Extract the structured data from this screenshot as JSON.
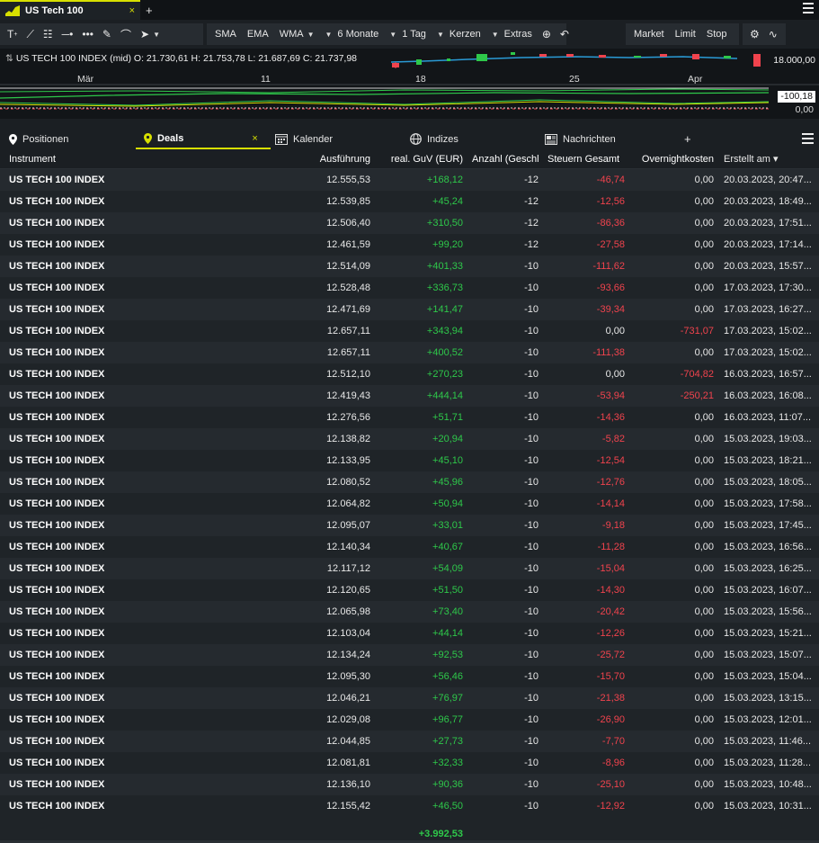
{
  "chart_tab": {
    "label": "US Tech 100",
    "close": "×",
    "add": "+"
  },
  "toolbar": {
    "indicators": [
      "SMA",
      "EMA",
      "WMA"
    ],
    "period": "6 Monate",
    "interval": "1 Tag",
    "chart_type": "Kerzen",
    "extras": "Extras",
    "orders": [
      "Market",
      "Limit",
      "Stop"
    ]
  },
  "chart": {
    "instrument": "US TECH 100 INDEX (mid)",
    "ohlc": "O: 21.730,61  H: 21.753,78  L: 21.687,69  C: 21.737,98",
    "price_level": "18.000,00",
    "dates": [
      "Mär",
      "11",
      "18",
      "25",
      "Apr"
    ],
    "macd_value": "-100,18",
    "macd_zero": "0,00"
  },
  "deal_tabs": {
    "positionen": "Positionen",
    "deals": "Deals",
    "deals_close": "×",
    "kalender": "Kalender",
    "indizes": "Indizes",
    "nachrichten": "Nachrichten",
    "add": "+"
  },
  "table": {
    "headers": [
      "Instrument",
      "Ausführung",
      "real. GuV (EUR)",
      "Anzahl (Geschl",
      "Steuern Gesamt",
      "Overnightkosten",
      "Erstellt am ▾"
    ],
    "rows": [
      [
        "US TECH 100 INDEX",
        "12.555,53",
        "+168,12",
        "-12",
        "-46,74",
        "0,00",
        "20.03.2023, 20:47..."
      ],
      [
        "US TECH 100 INDEX",
        "12.539,85",
        "+45,24",
        "-12",
        "-12,56",
        "0,00",
        "20.03.2023, 18:49..."
      ],
      [
        "US TECH 100 INDEX",
        "12.506,40",
        "+310,50",
        "-12",
        "-86,36",
        "0,00",
        "20.03.2023, 17:51..."
      ],
      [
        "US TECH 100 INDEX",
        "12.461,59",
        "+99,20",
        "-12",
        "-27,58",
        "0,00",
        "20.03.2023, 17:14..."
      ],
      [
        "US TECH 100 INDEX",
        "12.514,09",
        "+401,33",
        "-10",
        "-111,62",
        "0,00",
        "20.03.2023, 15:57..."
      ],
      [
        "US TECH 100 INDEX",
        "12.528,48",
        "+336,73",
        "-10",
        "-93,66",
        "0,00",
        "17.03.2023, 17:30..."
      ],
      [
        "US TECH 100 INDEX",
        "12.471,69",
        "+141,47",
        "-10",
        "-39,34",
        "0,00",
        "17.03.2023, 16:27..."
      ],
      [
        "US TECH 100 INDEX",
        "12.657,11",
        "+343,94",
        "-10",
        "0,00",
        "-731,07",
        "17.03.2023, 15:02..."
      ],
      [
        "US TECH 100 INDEX",
        "12.657,11",
        "+400,52",
        "-10",
        "-111,38",
        "0,00",
        "17.03.2023, 15:02..."
      ],
      [
        "US TECH 100 INDEX",
        "12.512,10",
        "+270,23",
        "-10",
        "0,00",
        "-704,82",
        "16.03.2023, 16:57..."
      ],
      [
        "US TECH 100 INDEX",
        "12.419,43",
        "+444,14",
        "-10",
        "-53,94",
        "-250,21",
        "16.03.2023, 16:08..."
      ],
      [
        "US TECH 100 INDEX",
        "12.276,56",
        "+51,71",
        "-10",
        "-14,36",
        "0,00",
        "16.03.2023, 11:07..."
      ],
      [
        "US TECH 100 INDEX",
        "12.138,82",
        "+20,94",
        "-10",
        "-5,82",
        "0,00",
        "15.03.2023, 19:03..."
      ],
      [
        "US TECH 100 INDEX",
        "12.133,95",
        "+45,10",
        "-10",
        "-12,54",
        "0,00",
        "15.03.2023, 18:21..."
      ],
      [
        "US TECH 100 INDEX",
        "12.080,52",
        "+45,96",
        "-10",
        "-12,76",
        "0,00",
        "15.03.2023, 18:05..."
      ],
      [
        "US TECH 100 INDEX",
        "12.064,82",
        "+50,94",
        "-10",
        "-14,14",
        "0,00",
        "15.03.2023, 17:58..."
      ],
      [
        "US TECH 100 INDEX",
        "12.095,07",
        "+33,01",
        "-10",
        "-9,18",
        "0,00",
        "15.03.2023, 17:45..."
      ],
      [
        "US TECH 100 INDEX",
        "12.140,34",
        "+40,67",
        "-10",
        "-11,28",
        "0,00",
        "15.03.2023, 16:56..."
      ],
      [
        "US TECH 100 INDEX",
        "12.117,12",
        "+54,09",
        "-10",
        "-15,04",
        "0,00",
        "15.03.2023, 16:25..."
      ],
      [
        "US TECH 100 INDEX",
        "12.120,65",
        "+51,50",
        "-10",
        "-14,30",
        "0,00",
        "15.03.2023, 16:07..."
      ],
      [
        "US TECH 100 INDEX",
        "12.065,98",
        "+73,40",
        "-10",
        "-20,42",
        "0,00",
        "15.03.2023, 15:56..."
      ],
      [
        "US TECH 100 INDEX",
        "12.103,04",
        "+44,14",
        "-10",
        "-12,26",
        "0,00",
        "15.03.2023, 15:21..."
      ],
      [
        "US TECH 100 INDEX",
        "12.134,24",
        "+92,53",
        "-10",
        "-25,72",
        "0,00",
        "15.03.2023, 15:07..."
      ],
      [
        "US TECH 100 INDEX",
        "12.095,30",
        "+56,46",
        "-10",
        "-15,70",
        "0,00",
        "15.03.2023, 15:04..."
      ],
      [
        "US TECH 100 INDEX",
        "12.046,21",
        "+76,97",
        "-10",
        "-21,38",
        "0,00",
        "15.03.2023, 13:15..."
      ],
      [
        "US TECH 100 INDEX",
        "12.029,08",
        "+96,77",
        "-10",
        "-26,90",
        "0,00",
        "15.03.2023, 12:01..."
      ],
      [
        "US TECH 100 INDEX",
        "12.044,85",
        "+27,73",
        "-10",
        "-7,70",
        "0,00",
        "15.03.2023, 11:46..."
      ],
      [
        "US TECH 100 INDEX",
        "12.081,81",
        "+32,33",
        "-10",
        "-8,96",
        "0,00",
        "15.03.2023, 11:28..."
      ],
      [
        "US TECH 100 INDEX",
        "12.136,10",
        "+90,36",
        "-10",
        "-25,10",
        "0,00",
        "15.03.2023, 10:48..."
      ],
      [
        "US TECH 100 INDEX",
        "12.155,42",
        "+46,50",
        "-10",
        "-12,92",
        "0,00",
        "15.03.2023, 10:31..."
      ]
    ],
    "total": "+3.992,53"
  },
  "colors": {
    "accent": "#d8e000",
    "positive": "#2ec84a",
    "negative": "#f0434d"
  }
}
